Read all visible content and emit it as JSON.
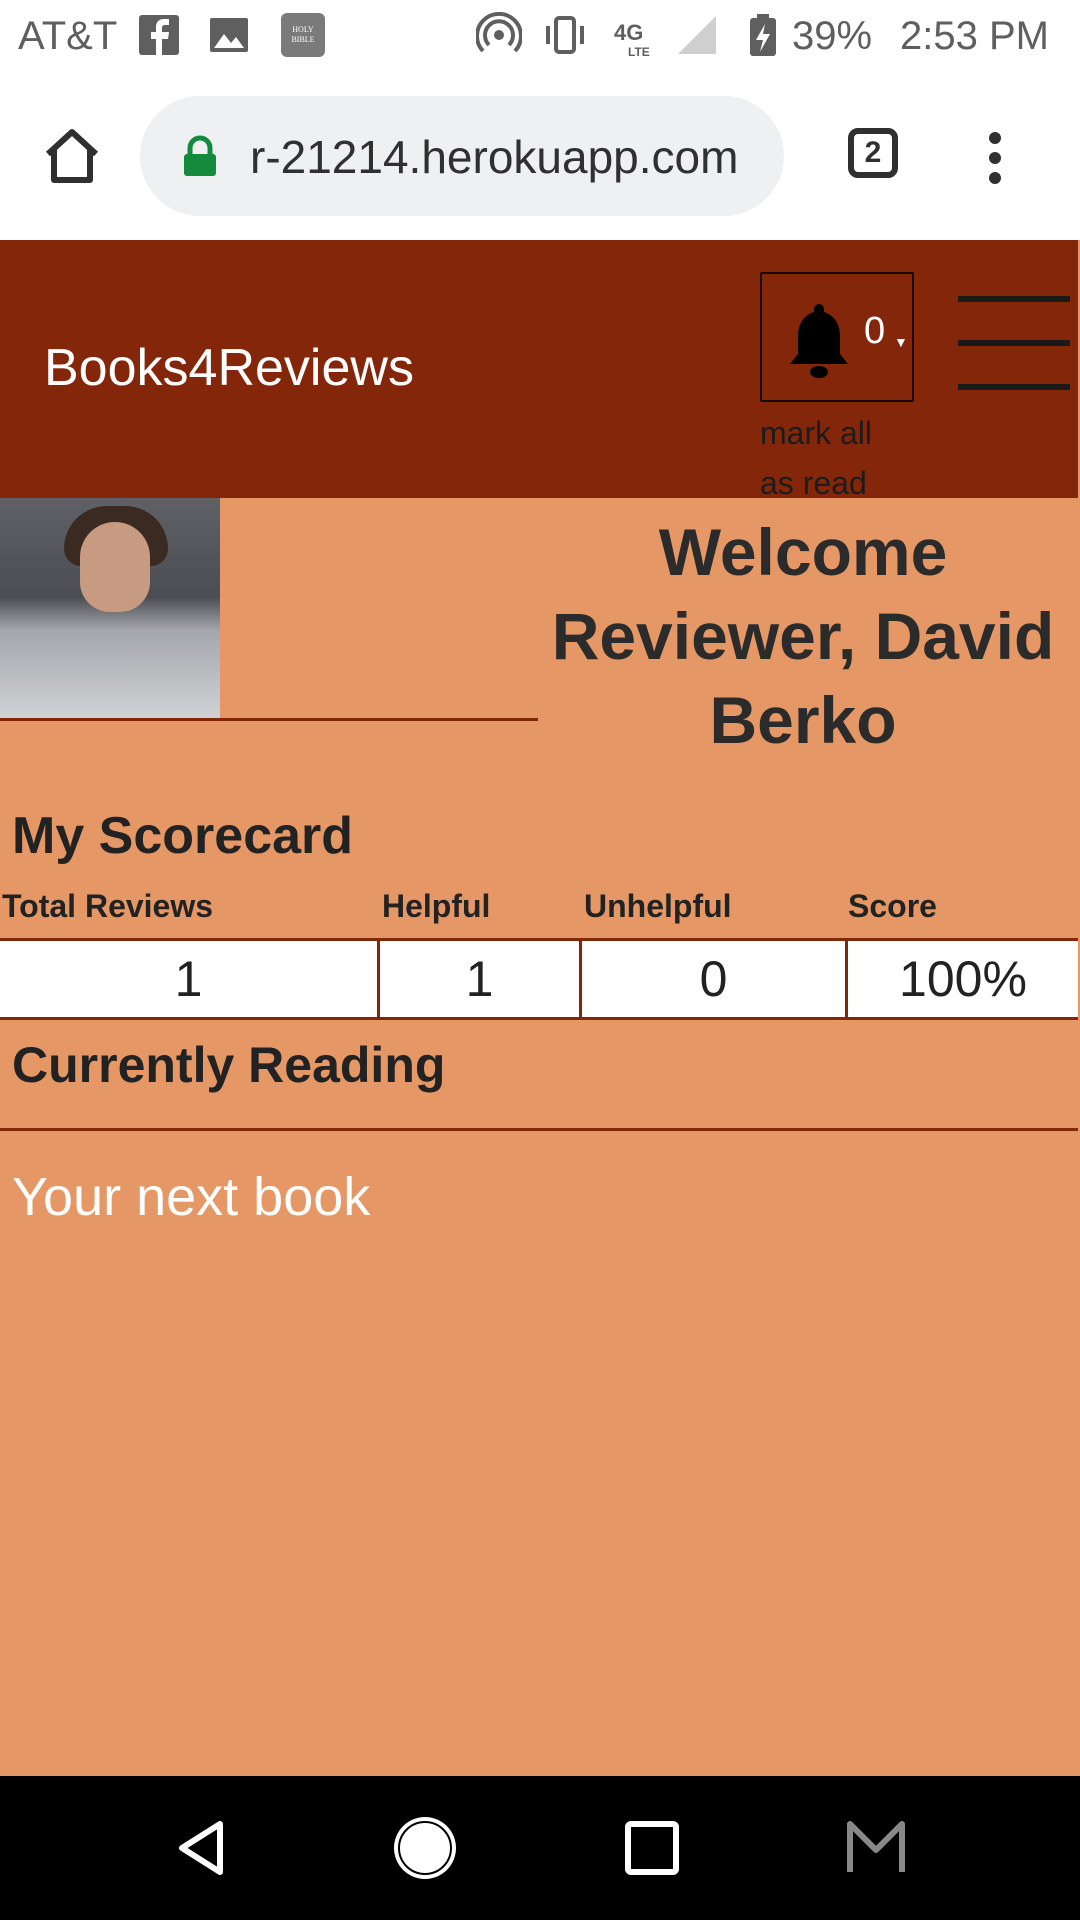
{
  "status_bar": {
    "carrier": "AT&T",
    "battery": "39%",
    "time": "2:53 PM",
    "icons": [
      "facebook-icon",
      "image-icon",
      "bible-app-icon",
      "hotspot-icon",
      "vibrate-icon",
      "network-4g-lte-icon",
      "signal-icon",
      "battery-charging-icon"
    ]
  },
  "browser": {
    "url": "r-21214.herokuapp.com",
    "tab_count": "2"
  },
  "site_nav": {
    "brand": "Books4Reviews",
    "notification_count": "0",
    "mark_all_read": "mark all as read"
  },
  "profile": {
    "welcome": "Welcome Reviewer, David Berko"
  },
  "scorecard": {
    "title": "My Scorecard",
    "headers": [
      "Total Reviews",
      "Helpful",
      "Unhelpful",
      "Score"
    ],
    "values": [
      "1",
      "1",
      "0",
      "100%"
    ]
  },
  "reading": {
    "title": "Currently Reading",
    "next_book": "Your next book"
  },
  "colors": {
    "page_background": "#e59866",
    "navbar": "#84260a",
    "accent_rule": "#84260a"
  }
}
